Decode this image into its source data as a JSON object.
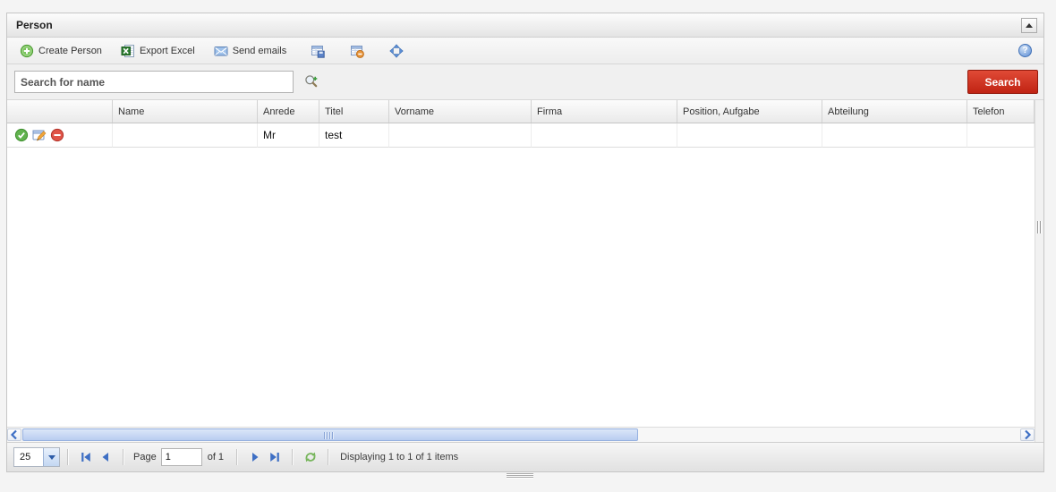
{
  "panel": {
    "title": "Person"
  },
  "toolbar": {
    "create_label": "Create Person",
    "export_label": "Export Excel",
    "send_label": "Send emails",
    "help_glyph": "?",
    "icons": {
      "create": "plus-circle-icon",
      "export": "excel-document-icon",
      "send": "envelope-icon",
      "save_grid": "table-save-icon",
      "remove_grid": "table-remove-icon",
      "move": "move-arrows-icon",
      "help": "help-circle-icon"
    }
  },
  "search": {
    "value": "Search for name",
    "button_label": "Search",
    "icon": "magnifier-zoom-icon"
  },
  "grid": {
    "columns": [
      "",
      "Name",
      "Anrede",
      "Titel",
      "Vorname",
      "Firma",
      "Position, Aufgabe",
      "Abteilung",
      "Telefon"
    ],
    "rows": [
      {
        "row_icons": [
          "approve-check-icon",
          "edit-icon",
          "delete-minus-icon"
        ],
        "name": "",
        "anrede": "Mr",
        "titel": "test",
        "vorname": "",
        "firma": "",
        "position_aufgabe": "",
        "abteilung": "",
        "telefon": ""
      }
    ]
  },
  "pager": {
    "page_size": "25",
    "page_label": "Page",
    "page_value": "1",
    "of_label": "of 1",
    "status": "Displaying 1 to 1 of 1 items"
  },
  "colors": {
    "search_button_red": "#c9281c",
    "scroll_thumb_blue": "#bdd0f0",
    "icon_green": "#5cb24a",
    "icon_red": "#e05448",
    "icon_blue": "#3e6fc4",
    "panel_border": "#c6c6c6"
  }
}
